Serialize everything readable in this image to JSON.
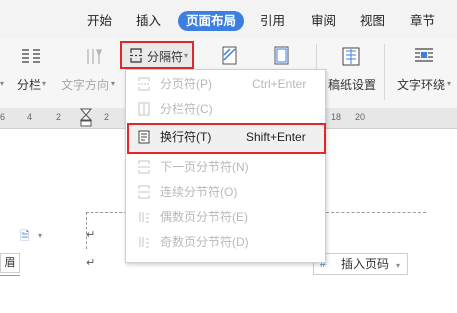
{
  "tabs": [
    "开始",
    "插入",
    "页面布局",
    "引用",
    "审阅",
    "视图",
    "章节"
  ],
  "active_tab": "页面布局",
  "ribbon": {
    "columns_label": "分栏",
    "text_direction_label": "文字方向",
    "separator_label": "分隔符",
    "draft_settings_label": "稿纸设置",
    "text_wrap_label": "文字环绕"
  },
  "ruler": [
    "6",
    "4",
    "2",
    "2",
    "18",
    "20"
  ],
  "menu": {
    "items": [
      {
        "label": "分页符(P)",
        "shortcut": "Ctrl+Enter",
        "enabled": false
      },
      {
        "label": "分栏符(C)",
        "shortcut": "",
        "enabled": false
      },
      {
        "label": "换行符(T)",
        "shortcut": "Shift+Enter",
        "enabled": true
      },
      {
        "label": "下一页分节符(N)",
        "shortcut": "",
        "enabled": false
      },
      {
        "label": "连续分节符(O)",
        "shortcut": "",
        "enabled": false
      },
      {
        "label": "偶数页分节符(E)",
        "shortcut": "",
        "enabled": false
      },
      {
        "label": "奇数页分节符(D)",
        "shortcut": "",
        "enabled": false
      }
    ]
  },
  "doc": {
    "header_label": "眉",
    "insert_page_number_label": "插入页码"
  },
  "colors": {
    "accent": "#3d7fe0",
    "highlight": "#e0282a"
  },
  "icons": {
    "section_break": "section-break-icon",
    "columns": "columns-icon",
    "text_direction": "text-direction-icon",
    "draft": "draft-settings-icon",
    "wrap": "text-wrap-icon",
    "paragraph_mark": "paragraph-mark"
  }
}
